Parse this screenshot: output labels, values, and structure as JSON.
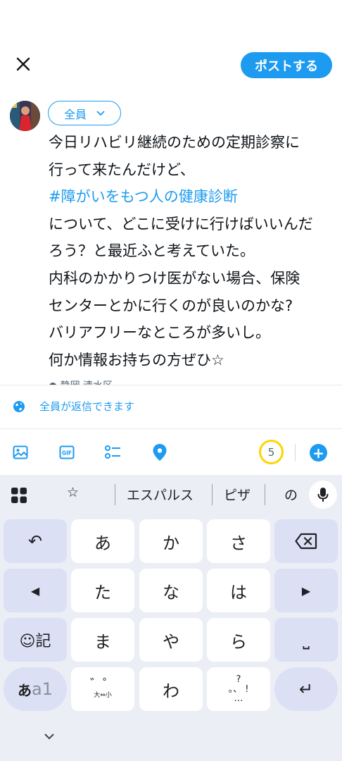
{
  "header": {
    "post_button": "ポストする"
  },
  "composer": {
    "audience": "全員",
    "text_lines": [
      "今日リハビリ継続のための定期診察に",
      "行って来たんだけど、",
      "#障がいをもつ人の健康診断",
      "について、どこに受けに行けばいいんだ",
      "ろう？と最近ふと考えていた。",
      "内科のかかりつけ医がない場合、保険",
      "センターとかに行くのが良いのかな?",
      "バリアフリーなところが多いし。",
      "何か情報お持ちの方ぜひ☆"
    ],
    "cut_line": "● 静岡 清水区",
    "reply_setting": "全員が返信できます"
  },
  "toolbar": {
    "icons": [
      "image-icon",
      "gif-icon",
      "poll-icon",
      "location-icon"
    ],
    "gif_label": "GIF",
    "char_counter": "5",
    "add_label": "+"
  },
  "keyboard": {
    "suggestions": [
      "☆",
      "エスパルス",
      "ピザ",
      "の"
    ],
    "keys": {
      "undo": "↶",
      "a": "あ",
      "ka": "か",
      "sa": "さ",
      "left": "◀",
      "ta": "た",
      "na": "な",
      "ha": "は",
      "right": "▶",
      "emoji_label": "☺記",
      "ma": "ま",
      "ya": "や",
      "ra": "ら",
      "space": "⎵",
      "mode_main": "あ",
      "mode_alt": "a1",
      "dakuten_main": "゛゜",
      "dakuten_sub": "大⇔小",
      "wa": "わ",
      "punct_top": "?",
      "punct_bottom": "。、 !",
      "punct_dots": "…",
      "enter": "↵"
    }
  },
  "colors": {
    "accent": "#1d9bf0",
    "counter_ring": "#ffd400",
    "keyboard_bg": "#eceef5",
    "function_key": "#dbe0f5"
  }
}
